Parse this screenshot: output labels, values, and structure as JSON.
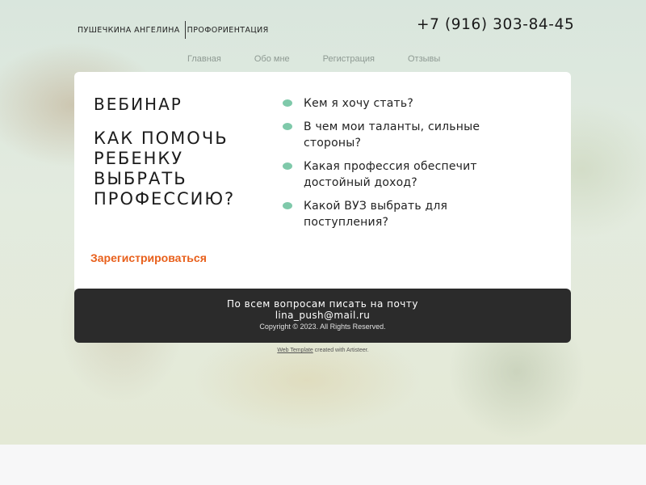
{
  "header": {
    "brand_name": "ПУШЕЧКИНА АНГЕЛИНА",
    "brand_tagline": "ПРОФОРИЕНТАЦИЯ",
    "phone": "+7 (916) 303-84-45"
  },
  "nav": {
    "items": [
      {
        "label": "Главная"
      },
      {
        "label": "Обо мне"
      },
      {
        "label": "Регистрация"
      },
      {
        "label": "Отзывы"
      }
    ]
  },
  "main": {
    "webinar": "ВЕБИНАР",
    "question_lines": [
      "КАК ПОМОЧЬ",
      "РЕБЕНКУ",
      "ВЫБРАТЬ",
      "ПРОФЕССИЮ?"
    ],
    "bullets": [
      {
        "lines": [
          "Кем я хочу стать?"
        ]
      },
      {
        "lines": [
          "В чем мои таланты, сильные",
          "стороны?"
        ]
      },
      {
        "lines": [
          "Какая профессия обеспечит",
          "достойный доход?"
        ]
      },
      {
        "lines": [
          "Какой ВУЗ  выбрать для",
          "поступления?"
        ]
      }
    ],
    "cta_label": "Зарегистрироваться",
    "bullet_color": "#7fc9aa",
    "cta_color": "#e8601c"
  },
  "footer": {
    "contact_text": "По всем вопросам писать на почту",
    "email": "lina_push@mail.ru",
    "copyright": "Copyright © 2023. All Rights Reserved."
  },
  "credits": {
    "link_text": "Web Template",
    "suffix": " created with Artisteer."
  }
}
